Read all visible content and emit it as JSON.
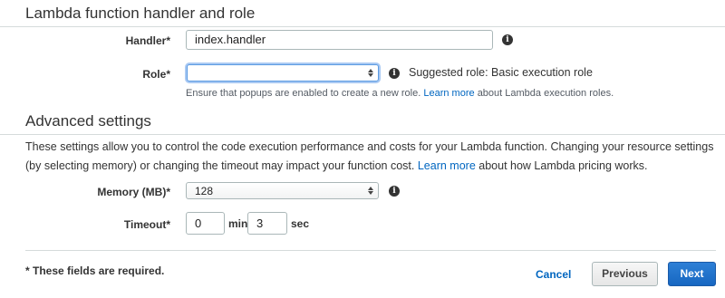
{
  "handler_section": {
    "title": "Lambda function handler and role",
    "handler_label": "Handler*",
    "handler_value": "index.handler",
    "role_label": "Role*",
    "role_value": "",
    "role_suggestion": "Suggested role: Basic execution role",
    "role_hint_pre": "Ensure that popups are enabled to create a new role.",
    "role_hint_link": "Learn more",
    "role_hint_post": "about Lambda execution roles."
  },
  "advanced_section": {
    "title": "Advanced settings",
    "desc_pre": "These settings allow you to control the code execution performance and costs for your Lambda function. Changing your resource settings (by selecting memory) or changing the timeout may impact your function cost.",
    "desc_link": "Learn more",
    "desc_post": "about how Lambda pricing works.",
    "memory_label": "Memory (MB)*",
    "memory_value": "128",
    "timeout_label": "Timeout*",
    "timeout_min_value": "0",
    "timeout_min_unit": "min",
    "timeout_sec_value": "3",
    "timeout_sec_unit": "sec"
  },
  "footer": {
    "required_note": "* These fields are required.",
    "cancel_label": "Cancel",
    "previous_label": "Previous",
    "next_label": "Next"
  },
  "icons": {
    "info": "info-icon",
    "select_arrows": "updown-arrows-icon"
  },
  "colors": {
    "link": "#0066c0",
    "primary_button": "#1767c1",
    "focus_ring": "#5a9ae2"
  }
}
